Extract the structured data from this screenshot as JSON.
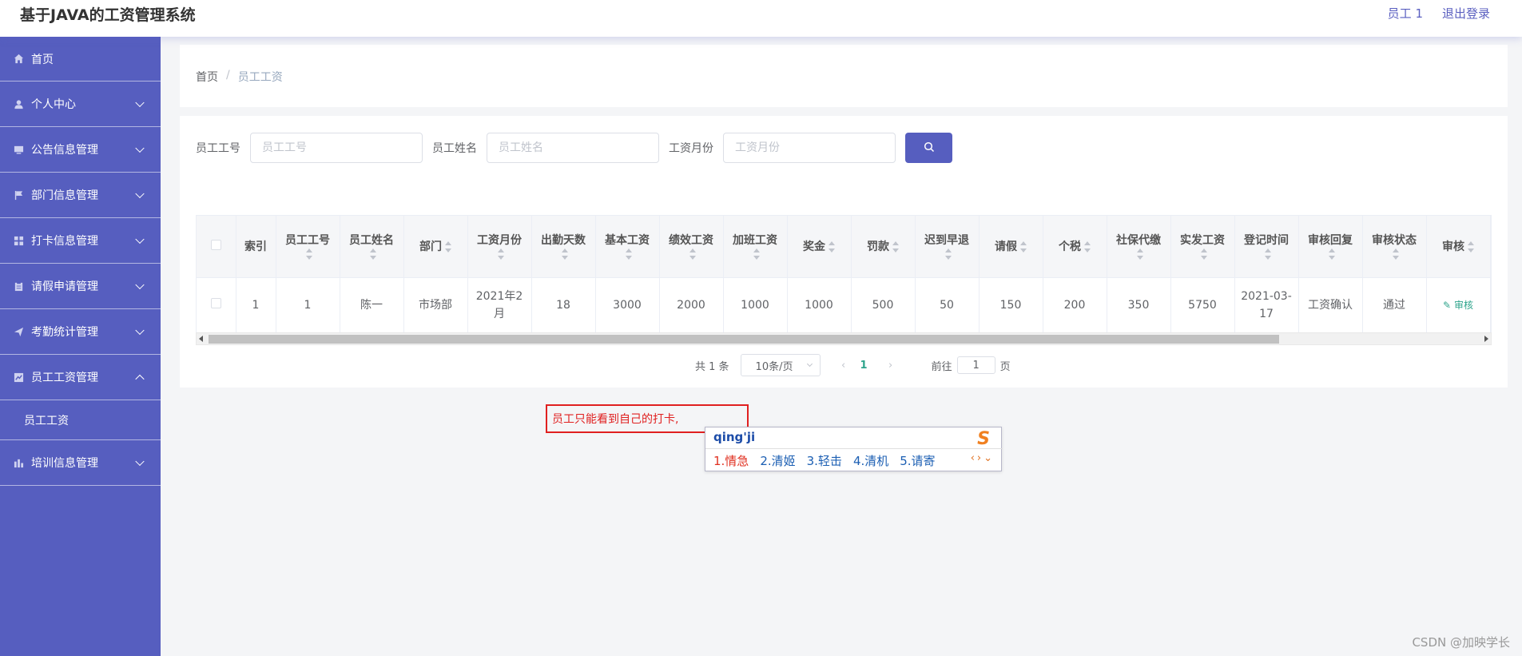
{
  "header": {
    "title": "基于JAVA的工资管理系统",
    "user": "员工 1",
    "logout": "退出登录"
  },
  "sidebar": {
    "items": [
      {
        "label": "首页",
        "icon": "home-icon"
      },
      {
        "label": "个人中心",
        "icon": "user-icon"
      },
      {
        "label": "公告信息管理",
        "icon": "monitor-icon"
      },
      {
        "label": "部门信息管理",
        "icon": "flag-icon"
      },
      {
        "label": "打卡信息管理",
        "icon": "grid-icon"
      },
      {
        "label": "请假申请管理",
        "icon": "clipboard-icon"
      },
      {
        "label": "考勤统计管理",
        "icon": "send-icon"
      },
      {
        "label": "员工工资管理",
        "icon": "chart-icon"
      },
      {
        "label": "培训信息管理",
        "icon": "bar-icon"
      }
    ],
    "submenu": "员工工资"
  },
  "breadcrumb": {
    "home": "首页",
    "sep": "/",
    "current": "员工工资"
  },
  "search": {
    "emp_no_label": "员工工号",
    "emp_no_placeholder": "员工工号",
    "emp_name_label": "员工姓名",
    "emp_name_placeholder": "员工姓名",
    "month_label": "工资月份",
    "month_placeholder": "工资月份"
  },
  "table": {
    "columns": [
      "索引",
      "员工工号",
      "员工姓名",
      "部门",
      "工资月份",
      "出勤天数",
      "基本工资",
      "绩效工资",
      "加班工资",
      "奖金",
      "罚款",
      "迟到早退",
      "请假",
      "个税",
      "社保代缴",
      "实发工资",
      "登记时间",
      "审核回复",
      "审核状态",
      "审核"
    ],
    "rows": [
      [
        "1",
        "1",
        "陈一",
        "市场部",
        "2021年2月",
        "18",
        "3000",
        "2000",
        "1000",
        "1000",
        "500",
        "50",
        "150",
        "200",
        "350",
        "5750",
        "2021-03-17",
        "工资确认",
        "通过",
        "审核"
      ]
    ]
  },
  "pagination": {
    "total": "共 1 条",
    "page_size": "10条/页",
    "current_page": "1",
    "goto_label": "前往",
    "goto_value": "1",
    "page_suffix": "页"
  },
  "annotation": {
    "text": "员工只能看到自己的打卡,"
  },
  "ime": {
    "composition": "qing'ji",
    "candidates": [
      "1.情急",
      "2.清姬",
      "3.轻击",
      "4.清机",
      "5.请寄"
    ]
  },
  "watermark": "CSDN @加映学长"
}
